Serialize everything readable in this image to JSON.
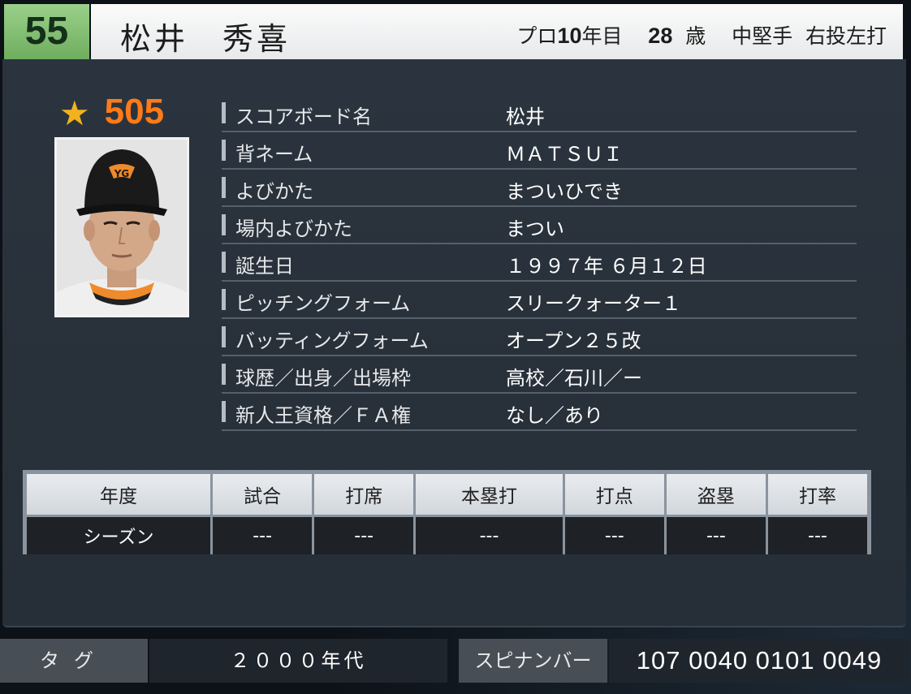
{
  "header": {
    "number": "55",
    "name": "松井　秀喜",
    "career_prefix": "プロ",
    "career_years": "10",
    "career_suffix": "年目",
    "age": "28",
    "age_unit": "歳",
    "position": "中堅手",
    "handedness": "右投左打"
  },
  "rating": {
    "icon": "star-icon",
    "value": "505"
  },
  "profile": {
    "rows": [
      {
        "label": "スコアボード名",
        "value": "松井"
      },
      {
        "label": "背ネーム",
        "value": "ＭＡＴＳＵＩ"
      },
      {
        "label": "よびかた",
        "value": "まついひでき"
      },
      {
        "label": "場内よびかた",
        "value": "まつい"
      },
      {
        "label": "誕生日",
        "value": "１９９７年 ６月１２日"
      },
      {
        "label": "ピッチングフォーム",
        "value": "スリークォーター１"
      },
      {
        "label": "バッティングフォーム",
        "value": "オープン２５改"
      },
      {
        "label": "球歴／出身／出場枠",
        "value": "高校／石川／ー"
      },
      {
        "label": "新人王資格／ＦＡ権",
        "value": "なし／あり"
      }
    ]
  },
  "stats": {
    "headers": [
      "年度",
      "試合",
      "打席",
      "本塁打",
      "打点",
      "盗塁",
      "打率"
    ],
    "row": [
      "シーズン",
      "---",
      "---",
      "---",
      "---",
      "---",
      "---"
    ]
  },
  "footer": {
    "tag_label": "タグ",
    "tag_value": "２０００年代",
    "spin_label": "スピナンバー",
    "spin_value": "107 0040 0101 0049"
  },
  "colors": {
    "number_badge": "#7dbb6a",
    "rating": "#ff7a18",
    "star": "#f2b21e"
  }
}
